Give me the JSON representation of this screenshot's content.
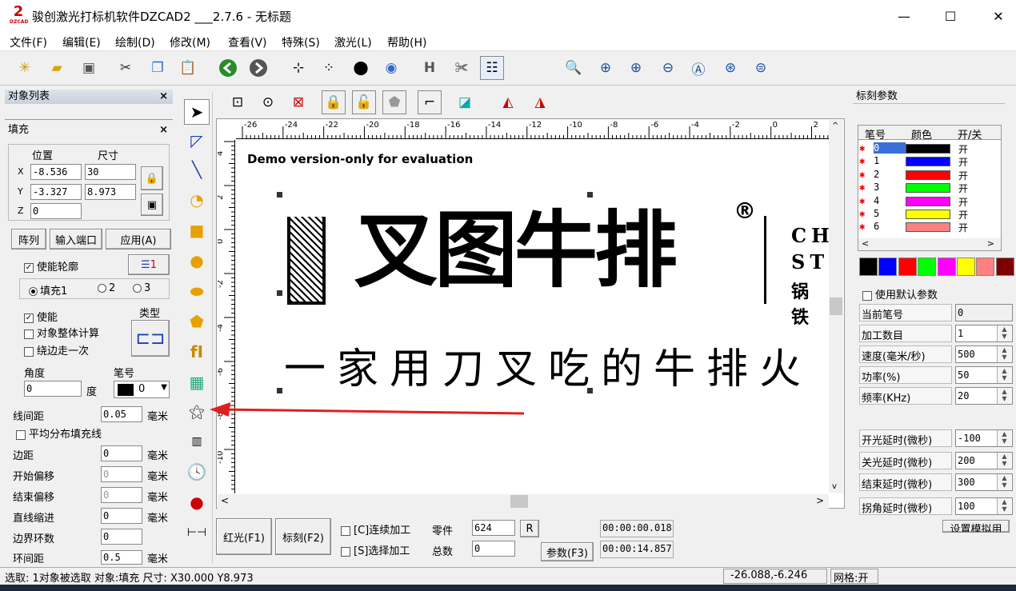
{
  "window": {
    "title": "骏创激光打标机软件DZCAD2 ___2.7.6 - 无标题",
    "logo": "2",
    "logo_sub": "DZCAD"
  },
  "menu": [
    "文件(F)",
    "编辑(E)",
    "绘制(D)",
    "修改(M)",
    "查看(V)",
    "特殊(S)",
    "激光(L)",
    "帮助(H)"
  ],
  "object_list": {
    "title": "对象列表"
  },
  "fill_panel": {
    "title": "填充",
    "pos_header": "位置",
    "size_header": "尺寸",
    "x_label": "X",
    "y_label": "Y",
    "z_label": "Z",
    "x_pos": "-8.536",
    "y_pos": "-3.327",
    "z_pos": "0",
    "x_size": "30",
    "y_size": "8.973",
    "array_btn": "阵列",
    "input_port_btn": "输入端口",
    "apply_btn": "应用(A)",
    "enable_contour": "使能轮廓",
    "fill1": "填充1",
    "fill2": "2",
    "fill3": "3",
    "enable": "使能",
    "type_label": "类型",
    "whole_calc": "对象整体计算",
    "edge_once": "绕边走一次",
    "angle_label": "角度",
    "angle_value": "0",
    "degree": "度",
    "pen_label": "笔号",
    "pen_value": "0",
    "line_spacing": "线间距",
    "line_spacing_value": "0.05",
    "mm": "毫米",
    "even_dist": "平均分布填充线",
    "margin": "边距",
    "margin_value": "0",
    "start_offset": "开始偏移",
    "start_offset_value": "0",
    "end_offset": "结束偏移",
    "end_offset_value": "0",
    "line_shrink": "直线缩进",
    "line_shrink_value": "0",
    "border_loops": "边界环数",
    "border_loops_value": "0",
    "loop_spacing": "环间距",
    "loop_spacing_value": "0.5"
  },
  "canvas": {
    "demo_text": "Demo version-only for evaluation",
    "brand_text": "叉图牛排",
    "registered": "®",
    "slogan": "一家用刀叉吃的牛排火",
    "side_text_1": "CH",
    "side_text_2": "ST",
    "side_text_3": "锅 铁",
    "ruler_labels": [
      "-26",
      "-24",
      "-22",
      "-20",
      "-18",
      "-16",
      "-14",
      "-12",
      "-10",
      "-8",
      "-6",
      "-4",
      "-2",
      "0",
      "2"
    ],
    "vruler_labels": [
      "4",
      "2",
      "0",
      "-2",
      "-4",
      "-6",
      "-8",
      "-10"
    ]
  },
  "bottom": {
    "red_light_btn": "红光(F1)",
    "mark_btn": "标刻(F2)",
    "continuous": "[C]连续加工",
    "select_process": "[S]选择加工",
    "parts_label": "零件",
    "parts_value": "624",
    "total_label": "总数",
    "total_value": "0",
    "r_btn": "R",
    "params_btn": "参数(F3)",
    "time1": "00:00:00.018",
    "time2": "00:00:14.857"
  },
  "marking_params": {
    "title": "标刻参数",
    "headers": [
      "笔号",
      "颜色",
      "开/关"
    ],
    "pens": [
      {
        "no": "0",
        "color": "#000000",
        "state": "开"
      },
      {
        "no": "1",
        "color": "#0000ff",
        "state": "开"
      },
      {
        "no": "2",
        "color": "#ff0000",
        "state": "开"
      },
      {
        "no": "3",
        "color": "#00ff00",
        "state": "开"
      },
      {
        "no": "4",
        "color": "#ff00ff",
        "state": "开"
      },
      {
        "no": "5",
        "color": "#ffff00",
        "state": "开"
      },
      {
        "no": "6",
        "color": "#ff8080",
        "state": "开"
      }
    ],
    "palette": [
      "#000000",
      "#0000ff",
      "#ff0000",
      "#00ff00",
      "#ff00ff",
      "#ffff00",
      "#ff8080",
      "#800000"
    ],
    "use_default": "使用默认参数",
    "current_pen": "当前笔号",
    "current_pen_value": "0",
    "count": "加工数目",
    "count_value": "1",
    "speed": "速度(毫米/秒)",
    "speed_value": "500",
    "power": "功率(%)",
    "power_value": "50",
    "freq": "频率(KHz)",
    "freq_value": "20",
    "on_delay": "开光延时(微秒)",
    "on_delay_value": "-100",
    "off_delay": "关光延时(微秒)",
    "off_delay_value": "200",
    "end_delay": "结束延时(微秒)",
    "end_delay_value": "300",
    "corner_delay": "拐角延时(微秒)",
    "corner_delay_value": "100",
    "set_btn": "设置模拟用"
  },
  "status": {
    "left": "选取: 1对象被选取 对象:填充 尺寸: X30.000 Y8.973",
    "coords": "-26.088,-6.246",
    "grid": "网格:开"
  },
  "colors": {
    "arrow": "#e02020",
    "panel_title": "#cfd6e2"
  }
}
